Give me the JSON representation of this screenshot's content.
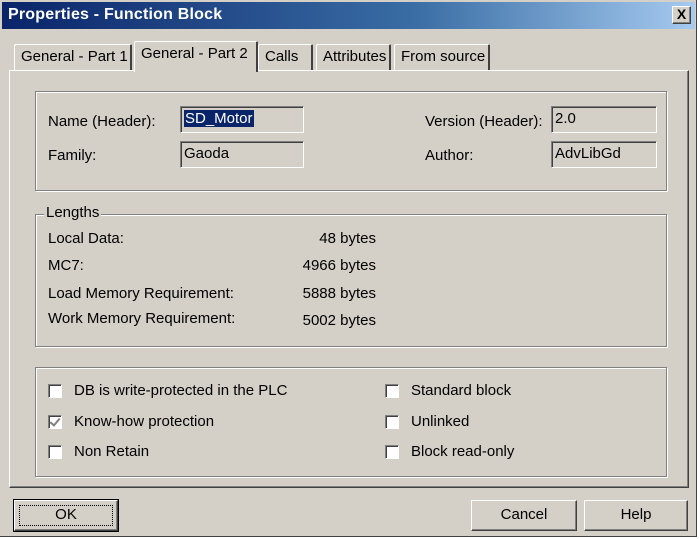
{
  "window": {
    "title": "Properties - Function Block",
    "close_glyph": "X"
  },
  "tabs": [
    {
      "label": "General - Part 1",
      "active": false
    },
    {
      "label": "General - Part 2",
      "active": true
    },
    {
      "label": "Calls",
      "active": false
    },
    {
      "label": "Attributes",
      "active": false
    },
    {
      "label": "From source",
      "active": false
    }
  ],
  "header": {
    "name_label": "Name (Header):",
    "name_value": "SD_Motor",
    "family_label": "Family:",
    "family_value": "Gaoda",
    "version_label": "Version (Header):",
    "version_value": "2.0",
    "author_label": "Author:",
    "author_value": "AdvLibGd"
  },
  "lengths": {
    "group_title": "Lengths",
    "rows": [
      {
        "label": "Local Data:",
        "value": "48 bytes"
      },
      {
        "label": "MC7:",
        "value": "4966 bytes"
      },
      {
        "label": "Load Memory Requirement:",
        "value": "5888 bytes"
      },
      {
        "label": "Work Memory Requirement:",
        "value": "5002 bytes"
      }
    ]
  },
  "flags": {
    "left": [
      {
        "label": "DB is write-protected in the PLC",
        "checked": false
      },
      {
        "label": "Know-how protection",
        "checked": true
      },
      {
        "label": "Non Retain",
        "checked": false
      }
    ],
    "right": [
      {
        "label": "Standard block",
        "checked": false
      },
      {
        "label": "Unlinked",
        "checked": false
      },
      {
        "label": "Block read-only",
        "checked": false
      }
    ]
  },
  "buttons": {
    "ok": "OK",
    "cancel": "Cancel",
    "help": "Help"
  },
  "colors": {
    "dialog_bg": "#d4d0c8",
    "title_gradient_start": "#0a246a",
    "title_gradient_end": "#a6caf0",
    "selection": "#0a246a"
  }
}
